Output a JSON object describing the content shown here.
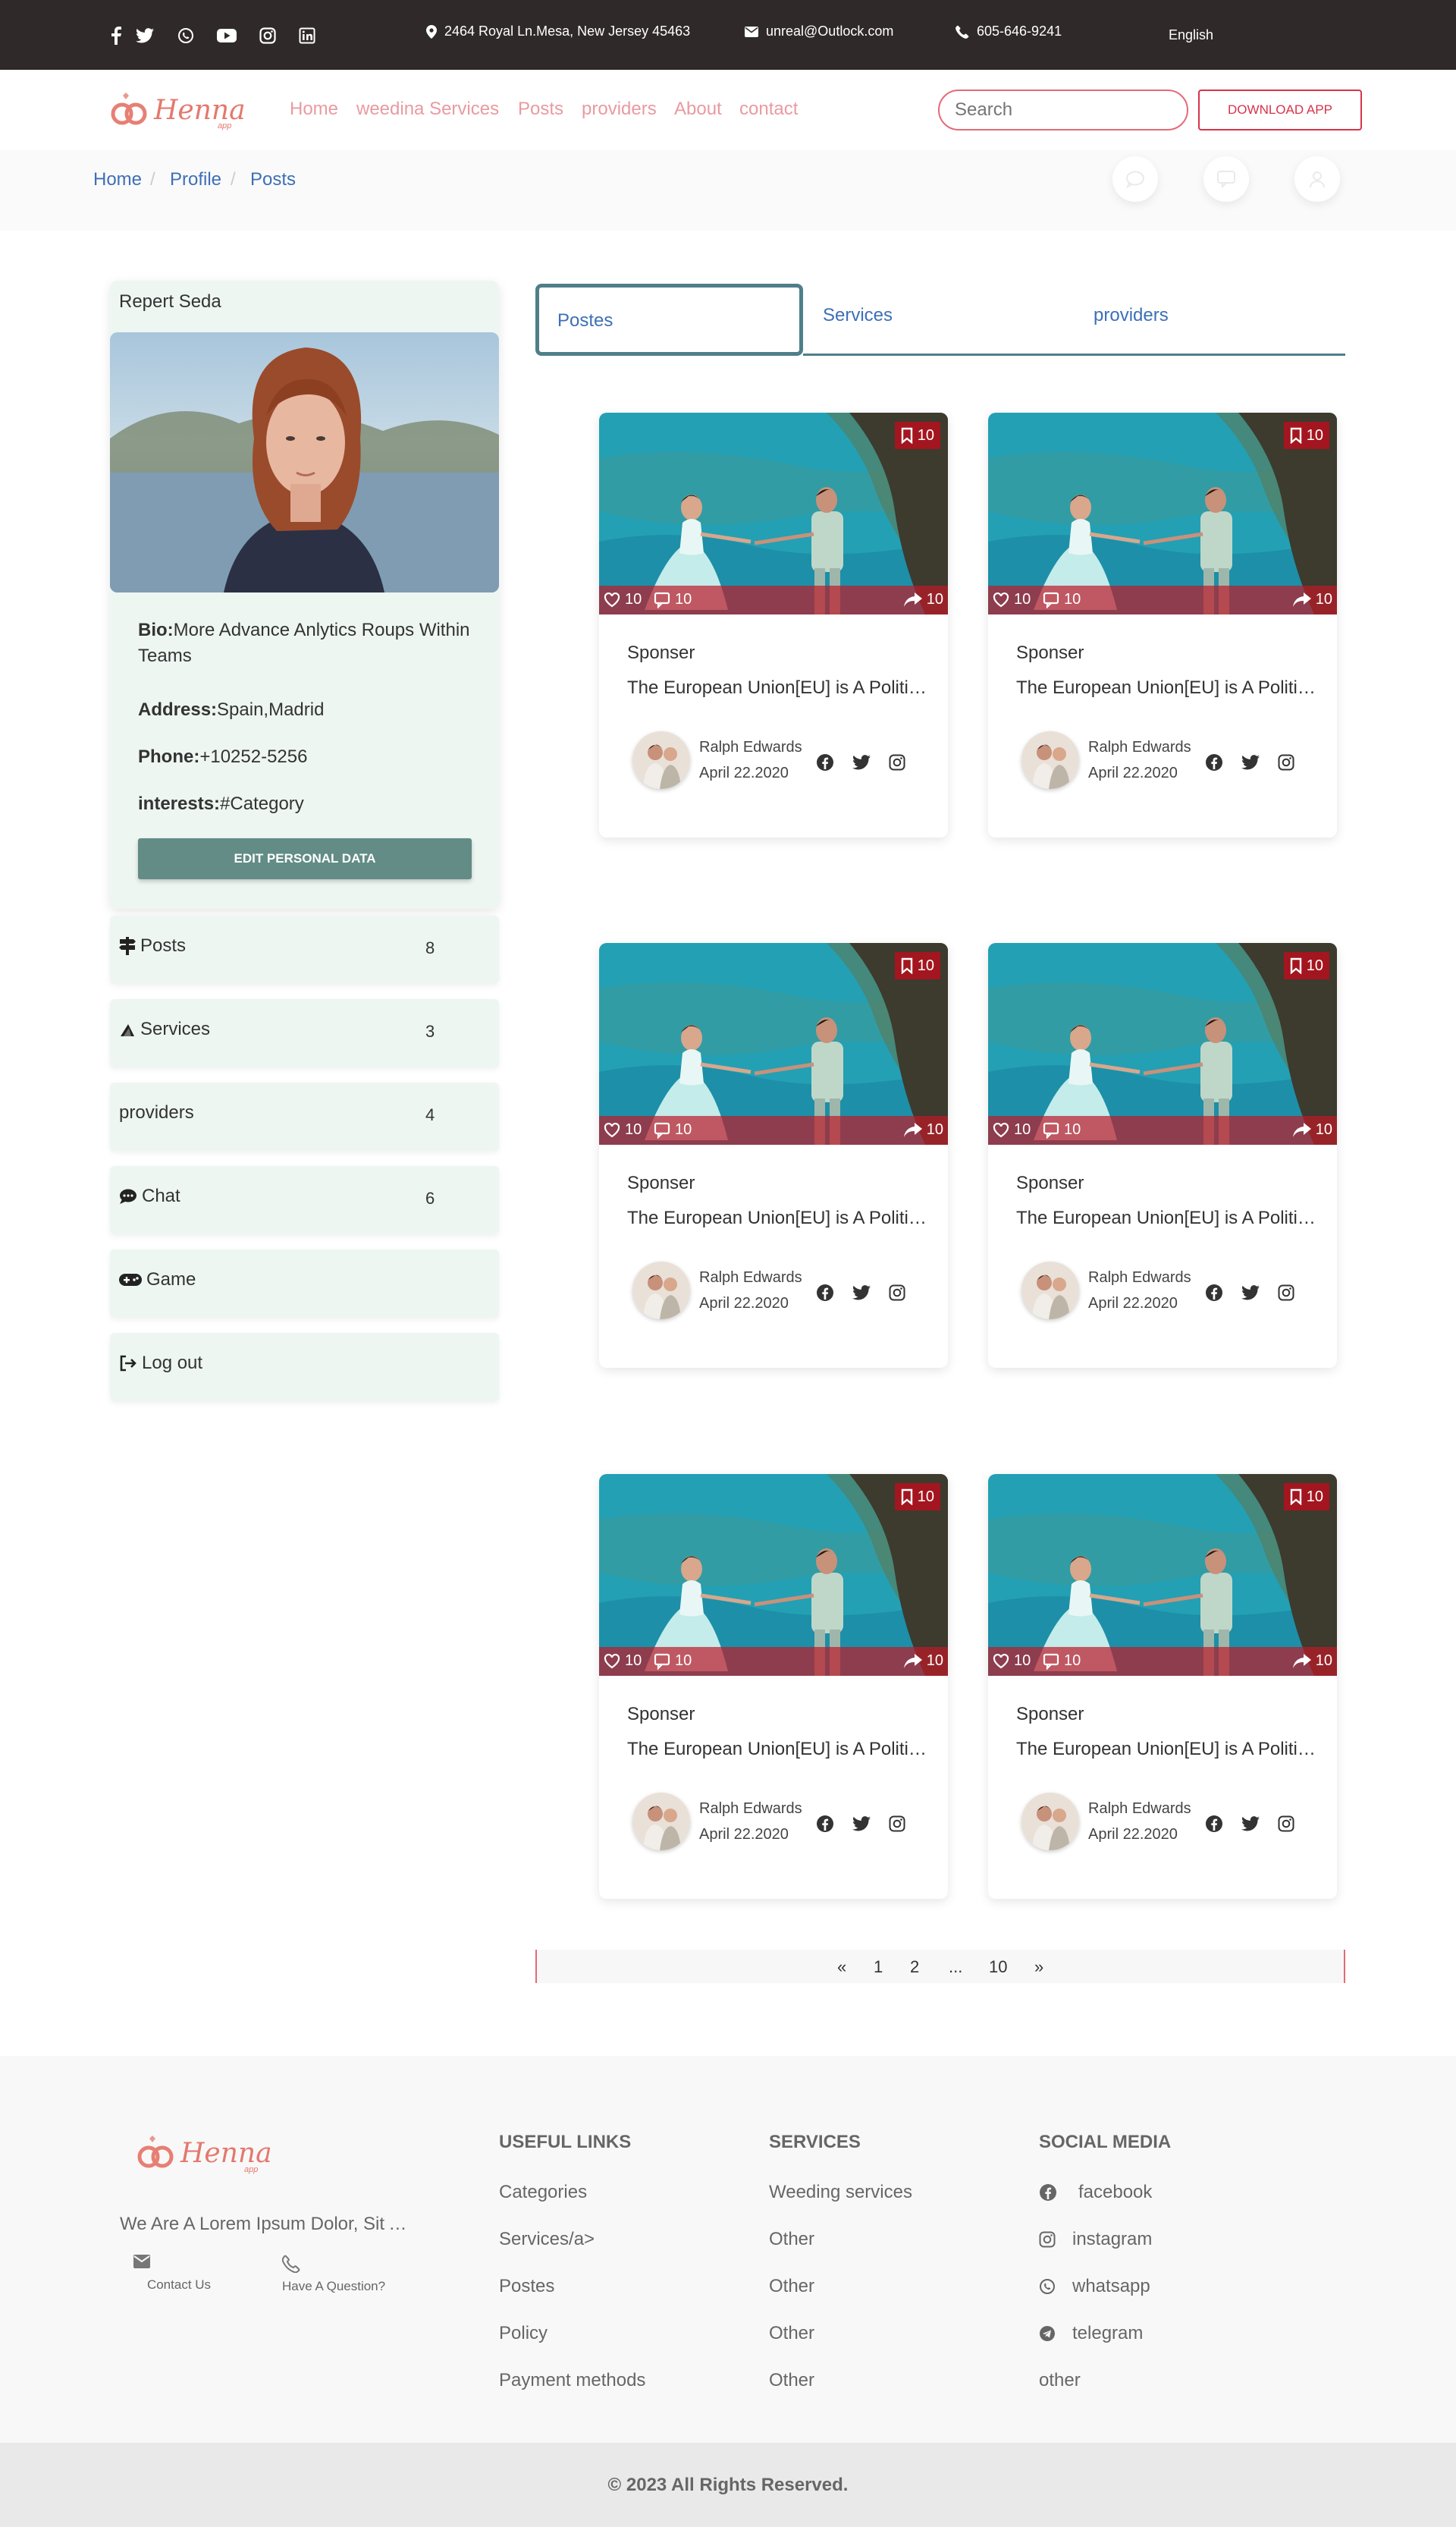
{
  "topbar": {
    "address": "2464 Royal Ln.Mesa, New Jersey 45463",
    "email": "unreal@Outlock.com",
    "phone": "605-646-9241",
    "language": "English"
  },
  "brand": {
    "logo_text": "Henna",
    "logo_sub": "app"
  },
  "nav": {
    "links": [
      "Home",
      "weedina Services",
      "Posts",
      "providers",
      "About",
      "contact"
    ],
    "search_placeholder": "Search",
    "download_label": "DOWNLOAD APP"
  },
  "breadcrumb": [
    "Home",
    "Profile",
    "Posts"
  ],
  "profile": {
    "name": "Repert Seda",
    "bio_label": "Bio:",
    "bio": "More Advance Anlytics Roups Within Teams",
    "address_label": "Address:",
    "address": "Spain,Madrid",
    "phone_label": "Phone:",
    "phone": "+10252-5256",
    "interests_label": "interests:",
    "interests": "#Category",
    "edit_label": "EDIT PERSONAL DATA"
  },
  "menu": [
    {
      "label": "Posts",
      "count": "8",
      "icon": "signpost-icon"
    },
    {
      "label": "Services",
      "count": "3",
      "icon": "wrench-icon"
    },
    {
      "label": "providers",
      "count": "4",
      "icon": ""
    },
    {
      "label": "Chat",
      "count": "6",
      "icon": "chat-icon"
    },
    {
      "label": "Game",
      "count": "",
      "icon": "gamepad-icon"
    },
    {
      "label": "Log out",
      "count": "",
      "icon": "logout-icon"
    }
  ],
  "tabs": [
    "Postes",
    "Services",
    "providers"
  ],
  "posts": [
    {
      "category": "Sponser",
      "title": "The European Union[EU] is A Political",
      "author": "Ralph Edwards",
      "date": "April 22.2020",
      "likes": "10",
      "comments": "10",
      "shares": "10",
      "saves": "10"
    },
    {
      "category": "Sponser",
      "title": "The European Union[EU] is A Political",
      "author": "Ralph Edwards",
      "date": "April 22.2020",
      "likes": "10",
      "comments": "10",
      "shares": "10",
      "saves": "10"
    },
    {
      "category": "Sponser",
      "title": "The European Union[EU] is A Political",
      "author": "Ralph Edwards",
      "date": "April 22.2020",
      "likes": "10",
      "comments": "10",
      "shares": "10",
      "saves": "10"
    },
    {
      "category": "Sponser",
      "title": "The European Union[EU] is A Political",
      "author": "Ralph Edwards",
      "date": "April 22.2020",
      "likes": "10",
      "comments": "10",
      "shares": "10",
      "saves": "10"
    },
    {
      "category": "Sponser",
      "title": "The European Union[EU] is A Political",
      "author": "Ralph Edwards",
      "date": "April 22.2020",
      "likes": "10",
      "comments": "10",
      "shares": "10",
      "saves": "10"
    },
    {
      "category": "Sponser",
      "title": "The European Union[EU] is A Political",
      "author": "Ralph Edwards",
      "date": "April 22.2020",
      "likes": "10",
      "comments": "10",
      "shares": "10",
      "saves": "10"
    }
  ],
  "pagination": [
    "«",
    "1",
    "2",
    "...",
    "10",
    "»"
  ],
  "footer": {
    "about": "We Are A Lorem Ipsum Dolor, Sit Amet",
    "contact_us": "Contact Us",
    "have_question": "Have A Question?",
    "useful_title": "USEFUL LINKS",
    "useful_links": [
      "Categories",
      "Services/a>",
      "Postes",
      "Policy",
      "Payment methods"
    ],
    "services_title": "SERVICES",
    "services_links": [
      "Weeding services",
      "Other",
      "Other",
      "Other",
      "Other"
    ],
    "social_title": "SOCIAL MEDIA",
    "social_links": [
      "facebook",
      "instagram",
      "whatsapp",
      "telegram",
      "other"
    ],
    "copyright": "© 2023 All Rights Reserved."
  },
  "colors": {
    "accent": "#e46a78",
    "dark": "#2f2a29",
    "link": "#3d6fb6",
    "teal": "#628c85",
    "sidebar_bg": "#eef6f2"
  }
}
